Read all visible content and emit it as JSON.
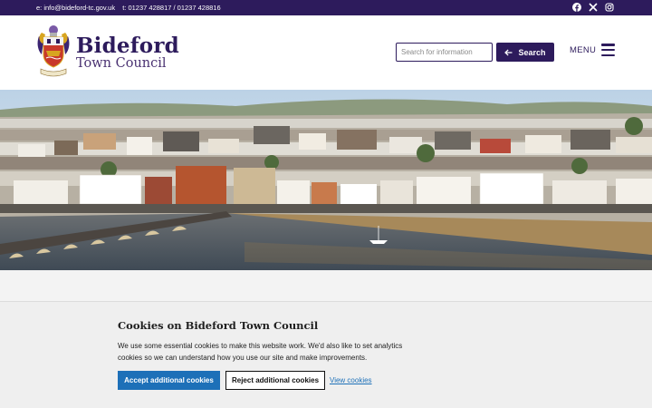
{
  "topbar": {
    "email": "e: info@bideford-tc.gov.uk",
    "phone": "t: 01237 428817 / 01237 428816",
    "social": [
      "facebook-icon",
      "x-icon",
      "instagram-icon"
    ]
  },
  "header": {
    "brand_line1": "Bideford",
    "brand_line2": "Town Council",
    "search_placeholder": "Search for information",
    "search_label": "Search",
    "menu_label": "MENU"
  },
  "hero": {
    "image": "aerial-photo-of-bideford-town-and-river"
  },
  "cookie": {
    "title": "Cookies on Bideford Town Council",
    "body": "We use some essential cookies to make this website work. We'd also like to set analytics cookies so we can understand how you use our site and make improvements.",
    "accept_label": "Accept additional cookies",
    "reject_label": "Reject additional cookies",
    "view_label": "View cookies"
  },
  "colors": {
    "brand_purple": "#2d1b5c",
    "link_blue": "#1d70b8",
    "banner_grey": "#efefef"
  }
}
